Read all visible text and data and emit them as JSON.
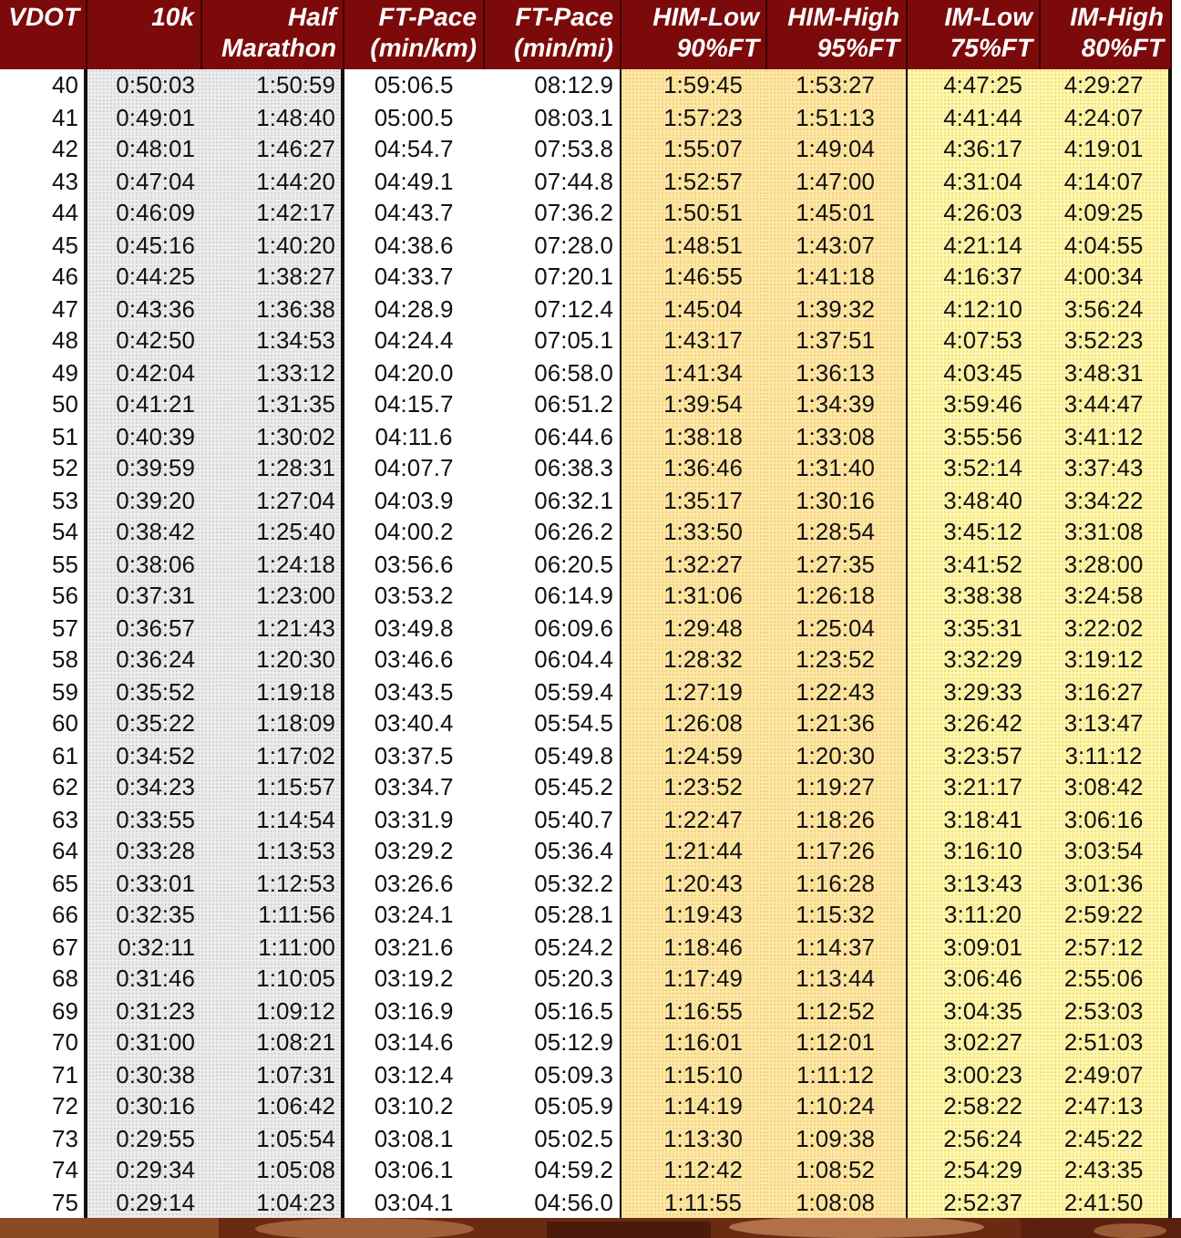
{
  "table": {
    "columns": [
      {
        "lines": [
          "VDOT"
        ],
        "kind": "plain"
      },
      {
        "lines": [
          "10k"
        ],
        "kind": "gray"
      },
      {
        "lines": [
          "Half",
          "Marathon"
        ],
        "kind": "gray"
      },
      {
        "lines": [
          "FT-Pace",
          "(min/km)"
        ],
        "kind": "plain"
      },
      {
        "lines": [
          "FT-Pace",
          "(min/mi)"
        ],
        "kind": "plain"
      },
      {
        "lines": [
          "HIM-Low",
          "90%FT"
        ],
        "kind": "orange"
      },
      {
        "lines": [
          "HIM-High",
          "95%FT"
        ],
        "kind": "orange"
      },
      {
        "lines": [
          "IM-Low",
          "75%FT"
        ],
        "kind": "yellow"
      },
      {
        "lines": [
          "IM-High",
          "80%FT"
        ],
        "kind": "yellow"
      }
    ],
    "rows": [
      [
        "40",
        "0:50:03",
        "1:50:59",
        "05:06.5",
        "08:12.9",
        "1:59:45",
        "1:53:27",
        "4:47:25",
        "4:29:27"
      ],
      [
        "41",
        "0:49:01",
        "1:48:40",
        "05:00.5",
        "08:03.1",
        "1:57:23",
        "1:51:13",
        "4:41:44",
        "4:24:07"
      ],
      [
        "42",
        "0:48:01",
        "1:46:27",
        "04:54.7",
        "07:53.8",
        "1:55:07",
        "1:49:04",
        "4:36:17",
        "4:19:01"
      ],
      [
        "43",
        "0:47:04",
        "1:44:20",
        "04:49.1",
        "07:44.8",
        "1:52:57",
        "1:47:00",
        "4:31:04",
        "4:14:07"
      ],
      [
        "44",
        "0:46:09",
        "1:42:17",
        "04:43.7",
        "07:36.2",
        "1:50:51",
        "1:45:01",
        "4:26:03",
        "4:09:25"
      ],
      [
        "45",
        "0:45:16",
        "1:40:20",
        "04:38.6",
        "07:28.0",
        "1:48:51",
        "1:43:07",
        "4:21:14",
        "4:04:55"
      ],
      [
        "46",
        "0:44:25",
        "1:38:27",
        "04:33.7",
        "07:20.1",
        "1:46:55",
        "1:41:18",
        "4:16:37",
        "4:00:34"
      ],
      [
        "47",
        "0:43:36",
        "1:36:38",
        "04:28.9",
        "07:12.4",
        "1:45:04",
        "1:39:32",
        "4:12:10",
        "3:56:24"
      ],
      [
        "48",
        "0:42:50",
        "1:34:53",
        "04:24.4",
        "07:05.1",
        "1:43:17",
        "1:37:51",
        "4:07:53",
        "3:52:23"
      ],
      [
        "49",
        "0:42:04",
        "1:33:12",
        "04:20.0",
        "06:58.0",
        "1:41:34",
        "1:36:13",
        "4:03:45",
        "3:48:31"
      ],
      [
        "50",
        "0:41:21",
        "1:31:35",
        "04:15.7",
        "06:51.2",
        "1:39:54",
        "1:34:39",
        "3:59:46",
        "3:44:47"
      ],
      [
        "51",
        "0:40:39",
        "1:30:02",
        "04:11.6",
        "06:44.6",
        "1:38:18",
        "1:33:08",
        "3:55:56",
        "3:41:12"
      ],
      [
        "52",
        "0:39:59",
        "1:28:31",
        "04:07.7",
        "06:38.3",
        "1:36:46",
        "1:31:40",
        "3:52:14",
        "3:37:43"
      ],
      [
        "53",
        "0:39:20",
        "1:27:04",
        "04:03.9",
        "06:32.1",
        "1:35:17",
        "1:30:16",
        "3:48:40",
        "3:34:22"
      ],
      [
        "54",
        "0:38:42",
        "1:25:40",
        "04:00.2",
        "06:26.2",
        "1:33:50",
        "1:28:54",
        "3:45:12",
        "3:31:08"
      ],
      [
        "55",
        "0:38:06",
        "1:24:18",
        "03:56.6",
        "06:20.5",
        "1:32:27",
        "1:27:35",
        "3:41:52",
        "3:28:00"
      ],
      [
        "56",
        "0:37:31",
        "1:23:00",
        "03:53.2",
        "06:14.9",
        "1:31:06",
        "1:26:18",
        "3:38:38",
        "3:24:58"
      ],
      [
        "57",
        "0:36:57",
        "1:21:43",
        "03:49.8",
        "06:09.6",
        "1:29:48",
        "1:25:04",
        "3:35:31",
        "3:22:02"
      ],
      [
        "58",
        "0:36:24",
        "1:20:30",
        "03:46.6",
        "06:04.4",
        "1:28:32",
        "1:23:52",
        "3:32:29",
        "3:19:12"
      ],
      [
        "59",
        "0:35:52",
        "1:19:18",
        "03:43.5",
        "05:59.4",
        "1:27:19",
        "1:22:43",
        "3:29:33",
        "3:16:27"
      ],
      [
        "60",
        "0:35:22",
        "1:18:09",
        "03:40.4",
        "05:54.5",
        "1:26:08",
        "1:21:36",
        "3:26:42",
        "3:13:47"
      ],
      [
        "61",
        "0:34:52",
        "1:17:02",
        "03:37.5",
        "05:49.8",
        "1:24:59",
        "1:20:30",
        "3:23:57",
        "3:11:12"
      ],
      [
        "62",
        "0:34:23",
        "1:15:57",
        "03:34.7",
        "05:45.2",
        "1:23:52",
        "1:19:27",
        "3:21:17",
        "3:08:42"
      ],
      [
        "63",
        "0:33:55",
        "1:14:54",
        "03:31.9",
        "05:40.7",
        "1:22:47",
        "1:18:26",
        "3:18:41",
        "3:06:16"
      ],
      [
        "64",
        "0:33:28",
        "1:13:53",
        "03:29.2",
        "05:36.4",
        "1:21:44",
        "1:17:26",
        "3:16:10",
        "3:03:54"
      ],
      [
        "65",
        "0:33:01",
        "1:12:53",
        "03:26.6",
        "05:32.2",
        "1:20:43",
        "1:16:28",
        "3:13:43",
        "3:01:36"
      ],
      [
        "66",
        "0:32:35",
        "1:11:56",
        "03:24.1",
        "05:28.1",
        "1:19:43",
        "1:15:32",
        "3:11:20",
        "2:59:22"
      ],
      [
        "67",
        "0:32:11",
        "1:11:00",
        "03:21.6",
        "05:24.2",
        "1:18:46",
        "1:14:37",
        "3:09:01",
        "2:57:12"
      ],
      [
        "68",
        "0:31:46",
        "1:10:05",
        "03:19.2",
        "05:20.3",
        "1:17:49",
        "1:13:44",
        "3:06:46",
        "2:55:06"
      ],
      [
        "69",
        "0:31:23",
        "1:09:12",
        "03:16.9",
        "05:16.5",
        "1:16:55",
        "1:12:52",
        "3:04:35",
        "2:53:03"
      ],
      [
        "70",
        "0:31:00",
        "1:08:21",
        "03:14.6",
        "05:12.9",
        "1:16:01",
        "1:12:01",
        "3:02:27",
        "2:51:03"
      ],
      [
        "71",
        "0:30:38",
        "1:07:31",
        "03:12.4",
        "05:09.3",
        "1:15:10",
        "1:11:12",
        "3:00:23",
        "2:49:07"
      ],
      [
        "72",
        "0:30:16",
        "1:06:42",
        "03:10.2",
        "05:05.9",
        "1:14:19",
        "1:10:24",
        "2:58:22",
        "2:47:13"
      ],
      [
        "73",
        "0:29:55",
        "1:05:54",
        "03:08.1",
        "05:02.5",
        "1:13:30",
        "1:09:38",
        "2:56:24",
        "2:45:22"
      ],
      [
        "74",
        "0:29:34",
        "1:05:08",
        "03:06.1",
        "04:59.2",
        "1:12:42",
        "1:08:52",
        "2:54:29",
        "2:43:35"
      ],
      [
        "75",
        "0:29:14",
        "1:04:23",
        "03:04.1",
        "04:56.0",
        "1:11:55",
        "1:08:08",
        "2:52:37",
        "2:41:50"
      ]
    ]
  }
}
